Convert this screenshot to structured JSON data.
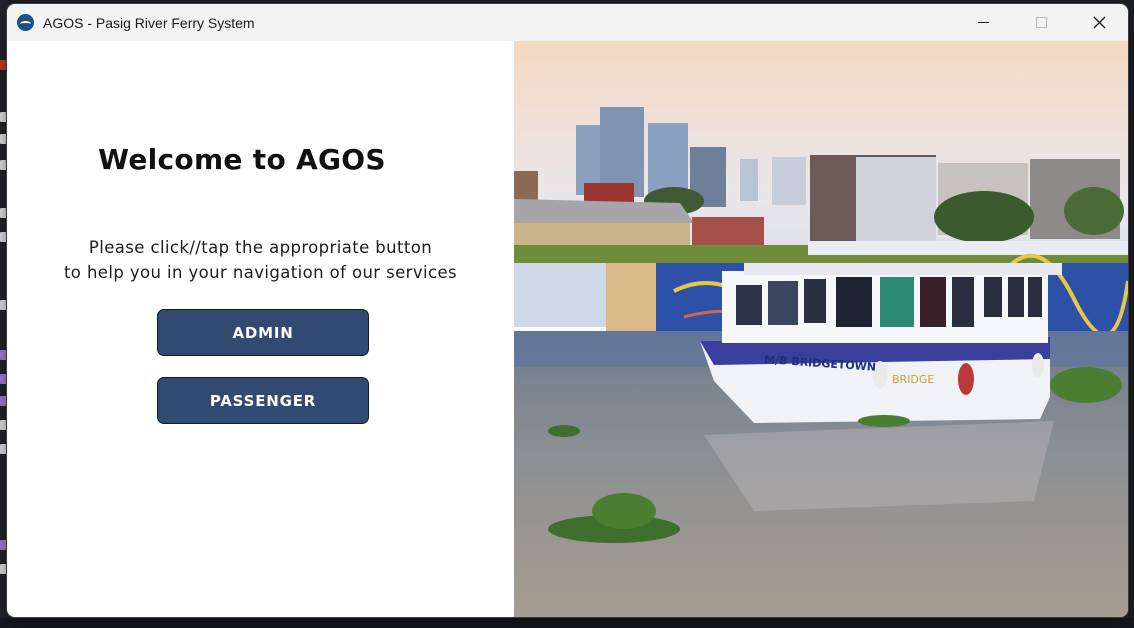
{
  "window": {
    "title": "AGOS - Pasig River Ferry System",
    "app_icon": "ferry-logo-icon",
    "controls": {
      "minimize": "minimize-icon",
      "maximize": "maximize-icon",
      "close": "close-icon"
    }
  },
  "main": {
    "heading": "Welcome to AGOS",
    "instructions": [
      "Please click//tap the appropriate button",
      "to help you in your navigation of our services"
    ],
    "buttons": {
      "admin": "ADMIN",
      "passenger": "PASSENGER"
    },
    "button_color": "#324a72"
  },
  "photo": {
    "subject": "ferry-photo",
    "boat_text": [
      "M/B BRIDGETOWN",
      "BRIDGE"
    ]
  }
}
